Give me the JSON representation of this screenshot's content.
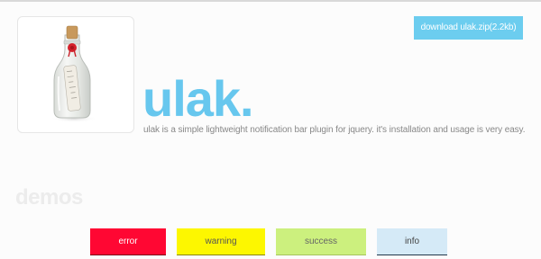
{
  "header": {
    "download_label": "download ulak.zip(2.2kb)"
  },
  "hero": {
    "title": "ulak.",
    "tagline": "ulak is a simple lightweight notification bar plugin for jquery. it's installation and usage is very easy."
  },
  "demos": {
    "heading": "demos",
    "buttons": [
      {
        "label": "error",
        "color": "#ff0733"
      },
      {
        "label": "warning",
        "color": "#fdf700"
      },
      {
        "label": "success",
        "color": "#ccf07e"
      },
      {
        "label": "info",
        "color": "#d5eaf7"
      }
    ]
  },
  "theme": {
    "accent": "#67c7ee",
    "download_button": "#6ccdef"
  },
  "icons": {
    "logo": "message-in-a-bottle-icon"
  }
}
